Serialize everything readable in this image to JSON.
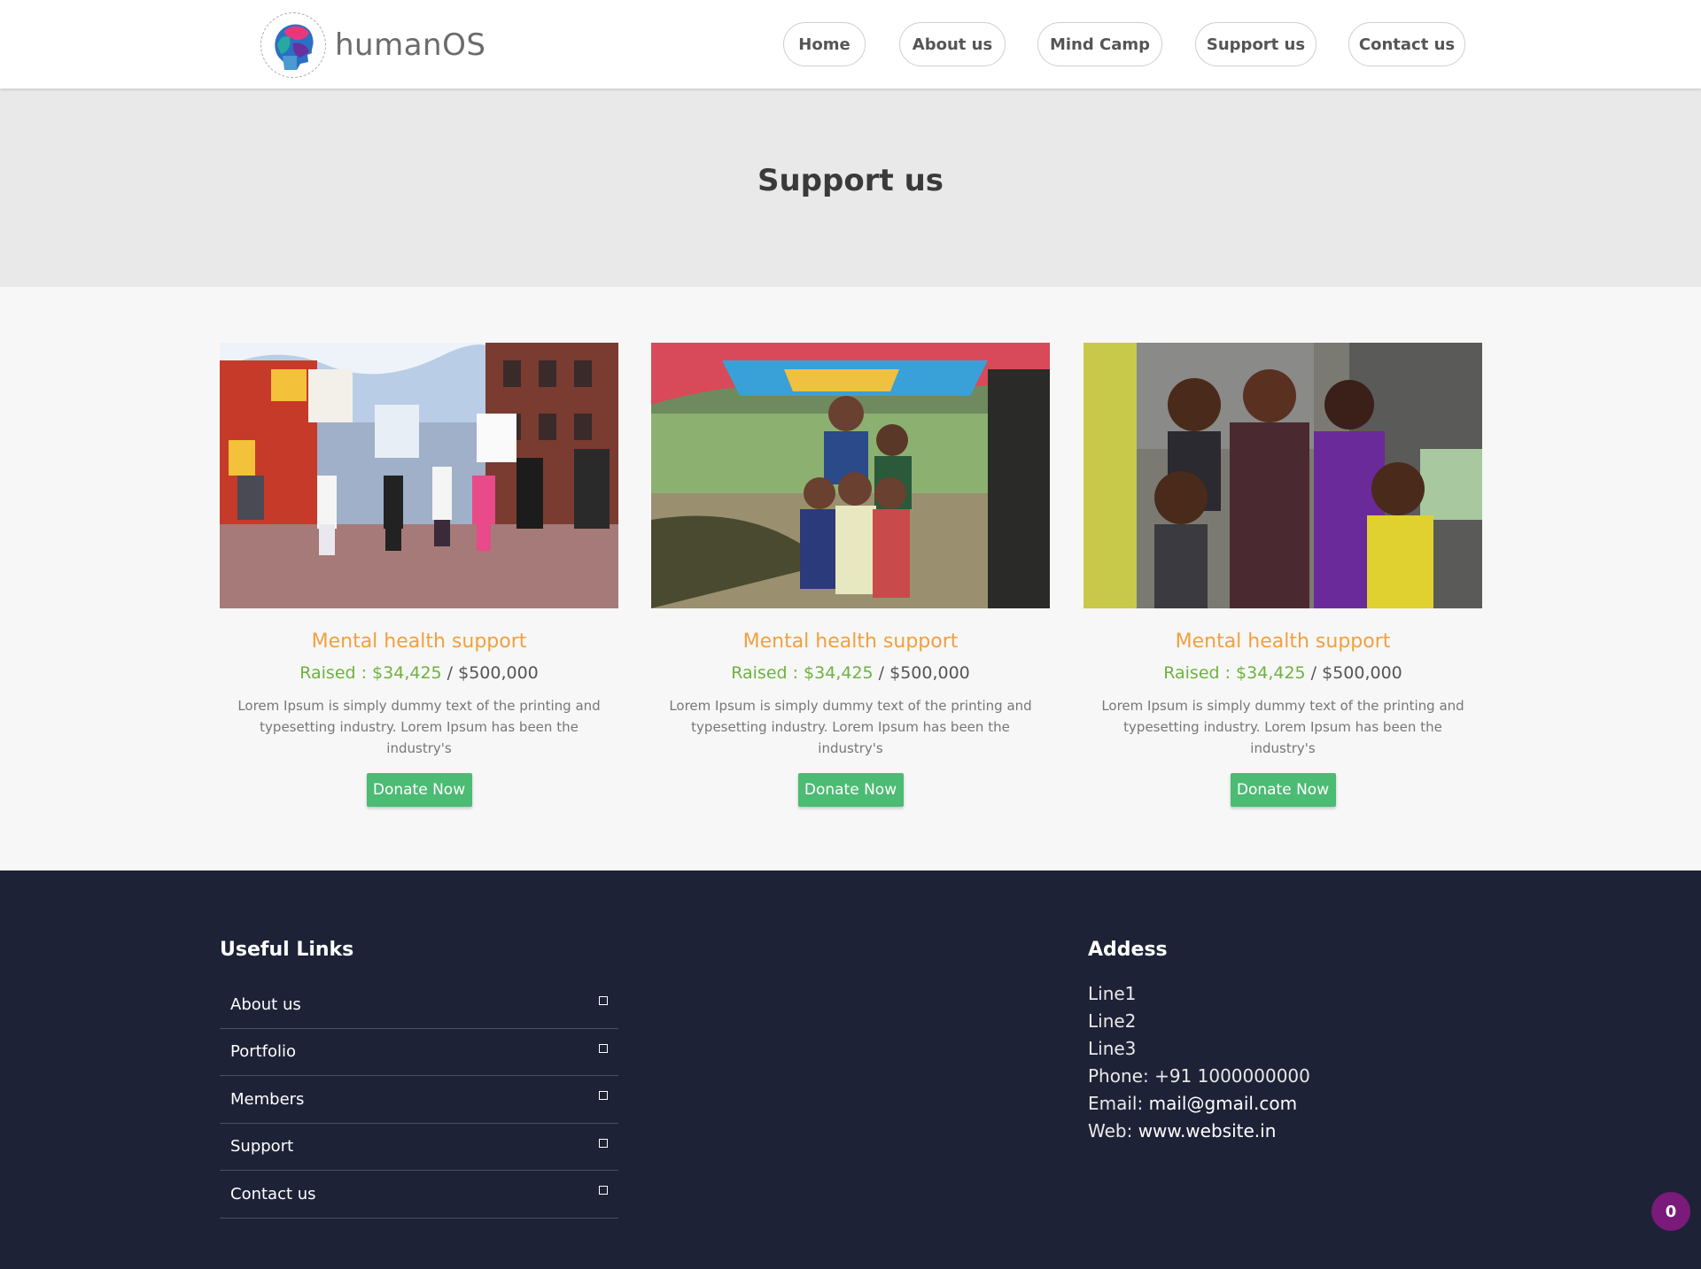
{
  "header": {
    "logo_text": "humanOS",
    "nav": [
      {
        "label": "Home"
      },
      {
        "label": "About us"
      },
      {
        "label": "Mind Camp"
      },
      {
        "label": "Support us"
      },
      {
        "label": "Contact us"
      }
    ]
  },
  "banner": {
    "title": "Support us"
  },
  "cards": [
    {
      "title": "Mental health support",
      "raised_label": "Raised : $34,425",
      "goal": " / $500,000",
      "description": "Lorem Ipsum is simply dummy text of the printing and typesetting industry. Lorem Ipsum has been the industry's",
      "button": "Donate Now"
    },
    {
      "title": "Mental health support",
      "raised_label": "Raised : $34,425",
      "goal": " / $500,000",
      "description": "Lorem Ipsum is simply dummy text of the printing and typesetting industry. Lorem Ipsum has been the industry's",
      "button": "Donate Now"
    },
    {
      "title": "Mental health support",
      "raised_label": "Raised : $34,425",
      "goal": " / $500,000",
      "description": "Lorem Ipsum is simply dummy text of the printing and typesetting industry. Lorem Ipsum has been the industry's",
      "button": "Donate Now"
    }
  ],
  "footer": {
    "links_heading": "Useful Links",
    "links": [
      {
        "label": "About us"
      },
      {
        "label": "Portfolio"
      },
      {
        "label": "Members"
      },
      {
        "label": "Support"
      },
      {
        "label": "Contact us"
      }
    ],
    "address_heading": "Addess",
    "address_lines": [
      "Line1",
      "Line2",
      "Line3"
    ],
    "phone_label": "Phone:",
    "phone": "+91 1000000000",
    "email_label": "Email:",
    "email": "mail@gmail.com",
    "web_label": "Web:",
    "web": "www.website.in"
  },
  "badge": {
    "count": "0"
  },
  "colors": {
    "accent_orange": "#f0a040",
    "raised_green": "#6db33f",
    "button_green": "#4cbb73",
    "footer_bg": "#1e2237",
    "badge_purple": "#7a1a7a"
  }
}
